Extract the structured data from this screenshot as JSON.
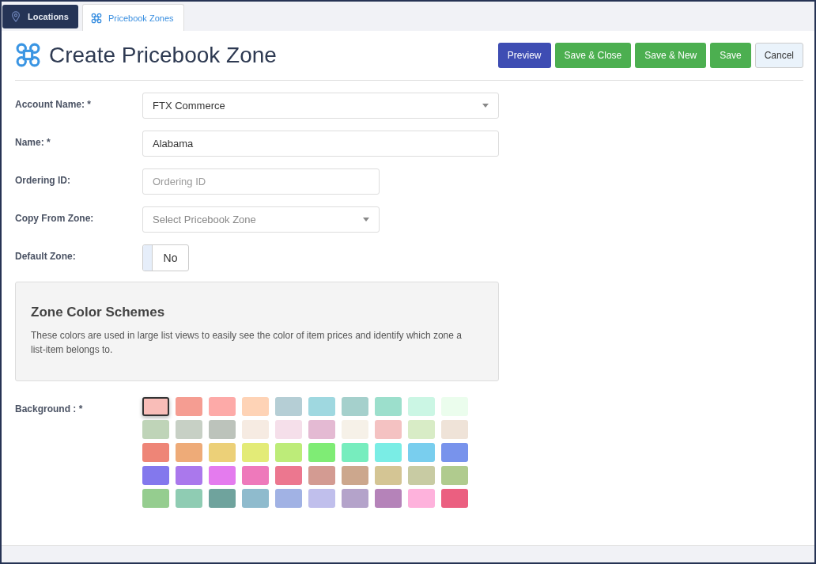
{
  "tabs": [
    {
      "label": "Locations",
      "kind": "pin",
      "selected": false
    },
    {
      "label": "Pricebook Zones",
      "kind": "zone",
      "selected": true
    }
  ],
  "page_title": "Create Pricebook Zone",
  "buttons": [
    {
      "label": "Preview",
      "kind": "primary"
    },
    {
      "label": "Save & Close",
      "kind": "success"
    },
    {
      "label": "Save & New",
      "kind": "success"
    },
    {
      "label": "Save",
      "kind": "success"
    },
    {
      "label": "Cancel",
      "kind": "default"
    }
  ],
  "fields": [
    {
      "label": "Account Name: *",
      "kind": "select",
      "value": "FTX Commerce",
      "wide": true
    },
    {
      "label": "Name: *",
      "kind": "text",
      "value": "Alabama",
      "wide": true
    },
    {
      "label": "Ordering ID:",
      "kind": "text",
      "placeholder": "Ordering ID",
      "wide": false
    },
    {
      "label": "Copy From Zone:",
      "kind": "select",
      "placeholder": "Select Pricebook Zone",
      "wide": false
    },
    {
      "label": "Default Zone:",
      "kind": "toggle",
      "value": "No",
      "on": false
    }
  ],
  "info_panel": {
    "title": "Zone Color Schemes",
    "text": "These colors are used in large list views to easily see the color of item prices and identify which zone a list-item belongs to."
  },
  "background": {
    "label": "Background : *",
    "swatches": [
      {
        "color": "#f9bdb8",
        "selected": true
      },
      {
        "color": "#f59d92",
        "selected": false
      },
      {
        "color": "#fdaaa8",
        "selected": false
      },
      {
        "color": "#fed3b6",
        "selected": false
      },
      {
        "color": "#b5ced5",
        "selected": false
      },
      {
        "color": "#9fd8e0",
        "selected": false
      },
      {
        "color": "#a5d0cc",
        "selected": false
      },
      {
        "color": "#9cdfcc",
        "selected": false
      },
      {
        "color": "#cbf6e4",
        "selected": false
      },
      {
        "color": "#ebfded",
        "selected": false
      },
      {
        "color": "#bfd4b8",
        "selected": false
      },
      {
        "color": "#c7d0c5",
        "selected": false
      },
      {
        "color": "#bcc3bb",
        "selected": false
      },
      {
        "color": "#f6ebe2",
        "selected": false
      },
      {
        "color": "#f5dfea",
        "selected": false
      },
      {
        "color": "#e4bad3",
        "selected": false
      },
      {
        "color": "#f6f1e8",
        "selected": false
      },
      {
        "color": "#f4c2c2",
        "selected": false
      },
      {
        "color": "#d8ecc6",
        "selected": false
      },
      {
        "color": "#efe3d8",
        "selected": false
      },
      {
        "color": "#ee8577",
        "selected": false
      },
      {
        "color": "#eeab78",
        "selected": false
      },
      {
        "color": "#ecd078",
        "selected": false
      },
      {
        "color": "#e3eb77",
        "selected": false
      },
      {
        "color": "#bdec79",
        "selected": false
      },
      {
        "color": "#7fec75",
        "selected": false
      },
      {
        "color": "#77edbe",
        "selected": false
      },
      {
        "color": "#7aede5",
        "selected": false
      },
      {
        "color": "#79ceee",
        "selected": false
      },
      {
        "color": "#7893ec",
        "selected": false
      },
      {
        "color": "#8378ed",
        "selected": false
      },
      {
        "color": "#aa78ec",
        "selected": false
      },
      {
        "color": "#e47bee",
        "selected": false
      },
      {
        "color": "#ee79bb",
        "selected": false
      },
      {
        "color": "#ec778f",
        "selected": false
      },
      {
        "color": "#d39b92",
        "selected": false
      },
      {
        "color": "#cca78d",
        "selected": false
      },
      {
        "color": "#d4c594",
        "selected": false
      },
      {
        "color": "#c8cba3",
        "selected": false
      },
      {
        "color": "#b0cb8e",
        "selected": false
      },
      {
        "color": "#95cd8f",
        "selected": false
      },
      {
        "color": "#8fccb3",
        "selected": false
      },
      {
        "color": "#6fa39d",
        "selected": false
      },
      {
        "color": "#8fbbcd",
        "selected": false
      },
      {
        "color": "#a1b2e4",
        "selected": false
      },
      {
        "color": "#c0bfec",
        "selected": false
      },
      {
        "color": "#b4a3ca",
        "selected": false
      },
      {
        "color": "#b583b9",
        "selected": false
      },
      {
        "color": "#feb2dc",
        "selected": false
      },
      {
        "color": "#eb5f80",
        "selected": false
      }
    ]
  }
}
